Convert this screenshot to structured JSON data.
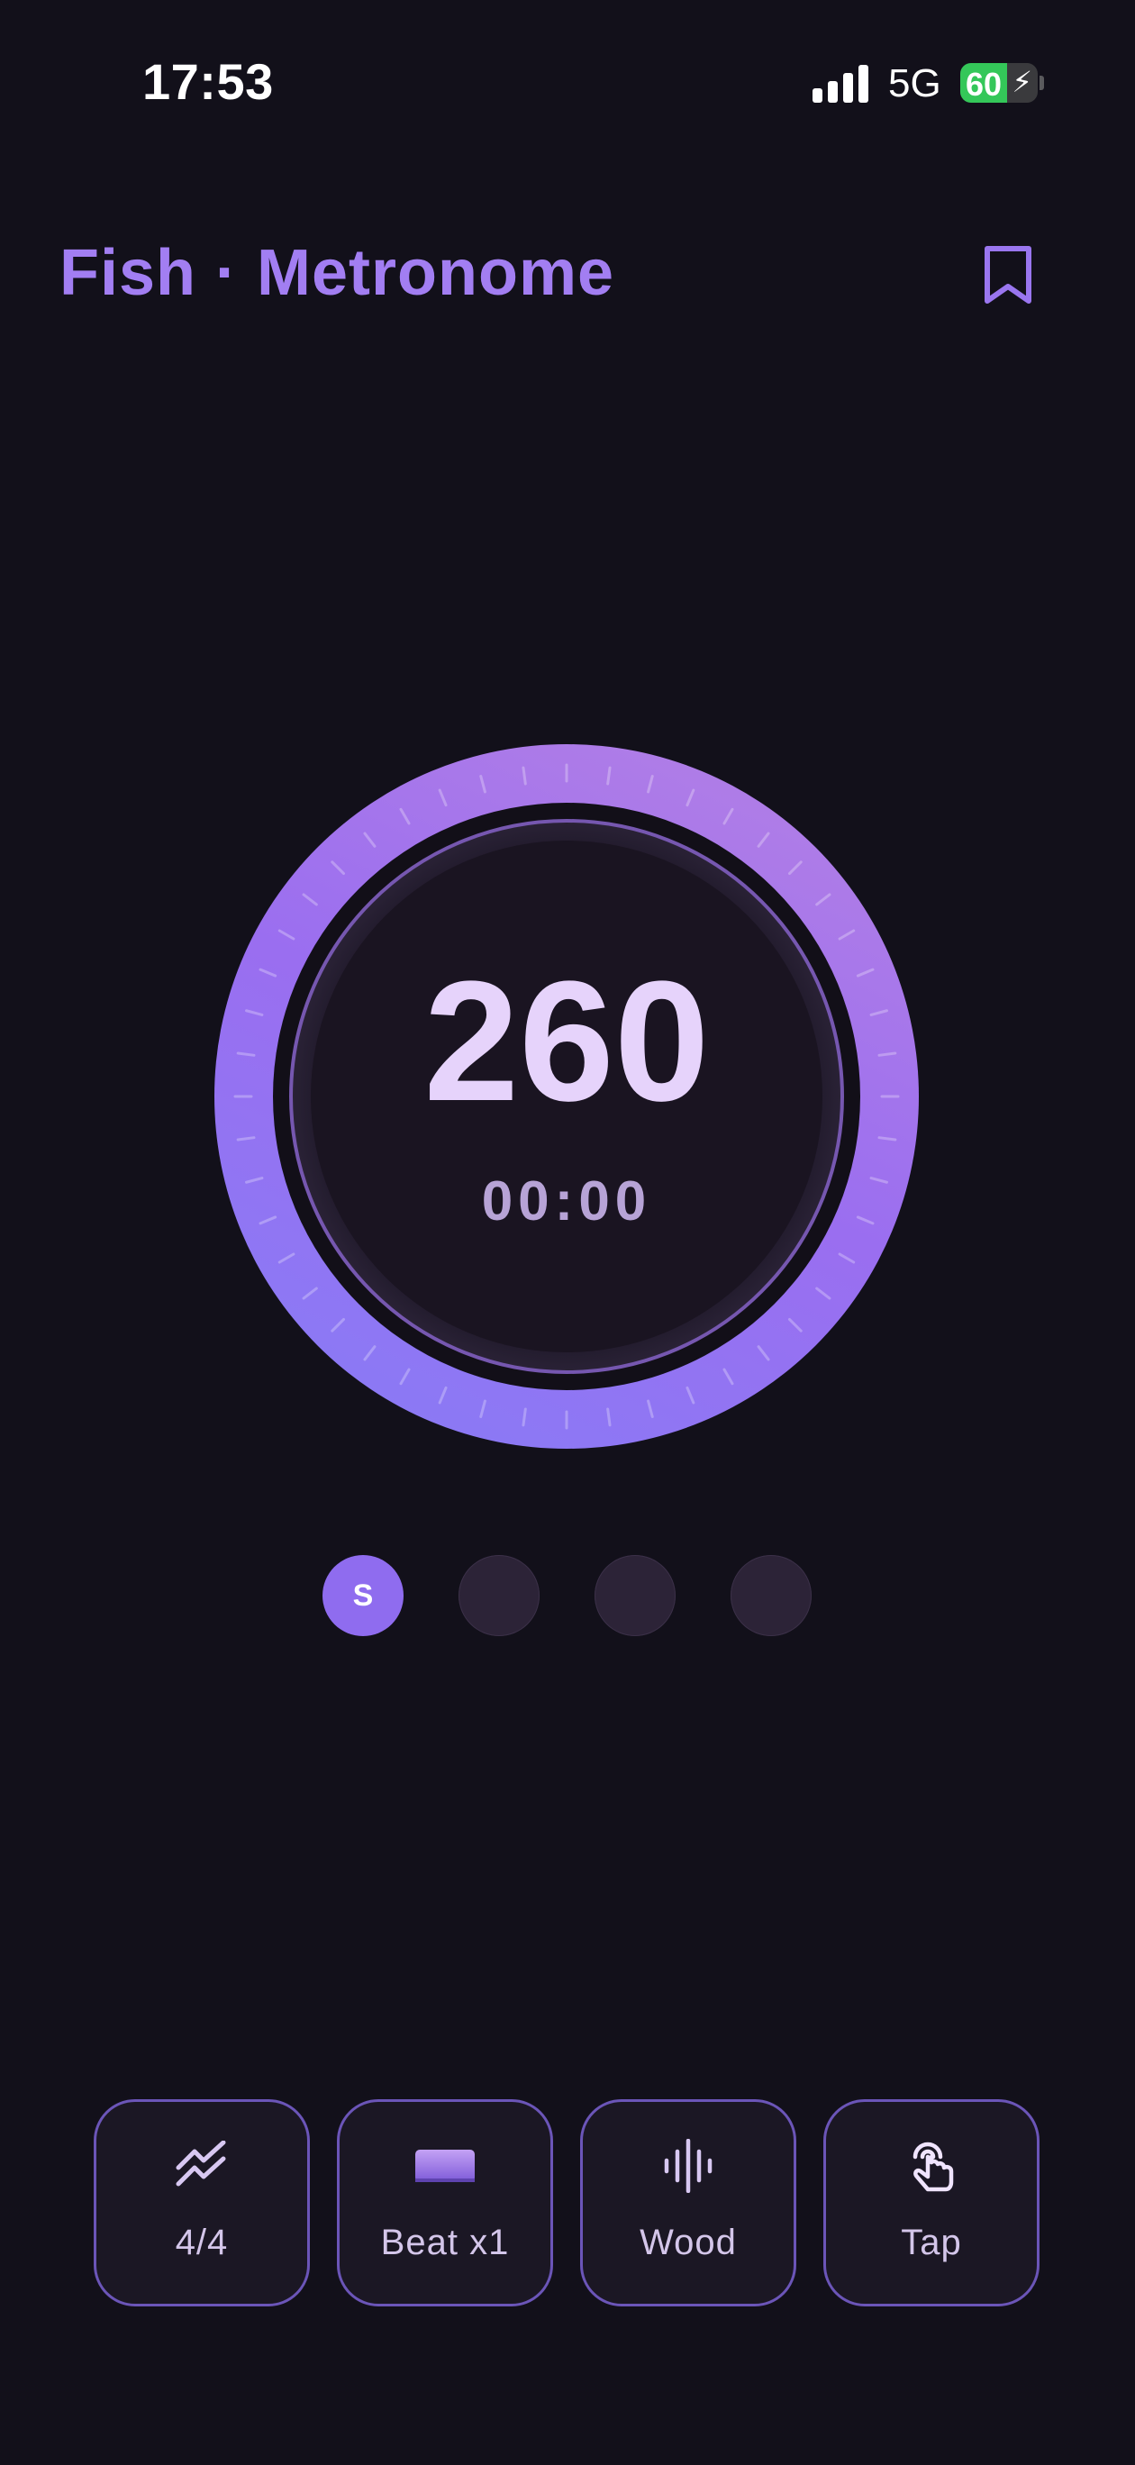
{
  "status_bar": {
    "time": "17:53",
    "network": "5G",
    "battery_percent": "60",
    "battery_level": 0.6
  },
  "header": {
    "title": "Fish · Metronome",
    "bookmark_icon": "bookmark-icon"
  },
  "dial": {
    "bpm": "260",
    "elapsed": "00:00"
  },
  "beats": [
    {
      "label": "S",
      "active": true
    },
    {
      "label": "",
      "active": false
    },
    {
      "label": "",
      "active": false
    },
    {
      "label": "",
      "active": false
    }
  ],
  "controls": [
    {
      "label": "4/4",
      "icon": "time-signature-icon"
    },
    {
      "label": "Beat x1",
      "icon": "beat-pad-icon"
    },
    {
      "label": "Wood",
      "icon": "sound-wave-icon"
    },
    {
      "label": "Tap",
      "icon": "tap-hand-icon"
    }
  ],
  "colors": {
    "background": "#12101a",
    "accent": "#a27ef2",
    "ring_start": "#b17ee6",
    "ring_end": "#8a7af5",
    "bpm_text": "#e6d3fb",
    "active_beat": "#8f6cef"
  }
}
